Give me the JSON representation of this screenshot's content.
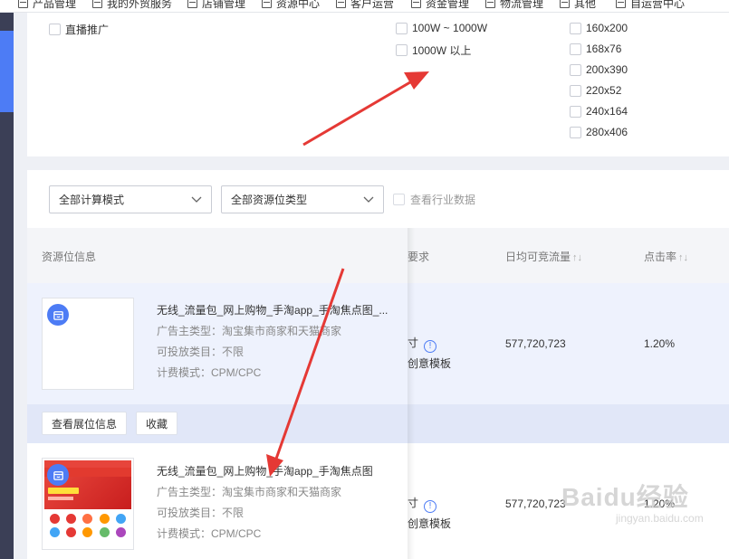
{
  "topnav": {
    "items": [
      "产品管理",
      "我的外贸服务",
      "店铺管理",
      "资源中心",
      "客户运营",
      "资金管理",
      "物流管理",
      "其他",
      "自运营中心"
    ]
  },
  "filters": {
    "promo_option": "直播推广",
    "traffic_options": [
      "100W ~ 1000W",
      "1000W 以上"
    ],
    "size_options": [
      "160x200",
      "168x76",
      "200x390",
      "220x52",
      "240x164",
      "280x406"
    ]
  },
  "toolbar": {
    "billing_select": "全部计算模式",
    "resource_type_select": "全部资源位类型",
    "industry_checkbox": "查看行业数据"
  },
  "table": {
    "headers": {
      "resource_info": "资源位信息",
      "requirement": "要求",
      "daily_traffic": "日均可竞流量",
      "ctr": "点击率",
      "sort_glyph": "↑↓"
    },
    "rows": [
      {
        "title": "无线_流量包_网上购物_手淘app_手淘焦点图_...",
        "advertiser": "广告主类型：淘宝集市商家和天猫商家",
        "category": "可投放类目：不限",
        "billing": "计费模式：CPM/CPC",
        "req_size": "寸",
        "req_template": "创意模板",
        "traffic": "577,720,723",
        "ctr": "1.20%"
      },
      {
        "title": "无线_流量包_网上购物_手淘app_手淘焦点图",
        "advertiser": "广告主类型：淘宝集市商家和天猫商家",
        "category": "可投放类目：不限",
        "billing": "计费模式：CPM/CPC",
        "req_size": "寸",
        "req_template": "创意模板",
        "traffic": "577,720,723",
        "ctr": "1.20%"
      }
    ],
    "actions": {
      "view_button": "查看展位信息",
      "favorite_button": "收藏"
    }
  },
  "watermark": {
    "brand": "Baidu经验",
    "url": "jingyan.baidu.com"
  },
  "colors": {
    "accent": "#4d7cf5",
    "arrow": "#e53935",
    "sidebar": "#3b3f56"
  }
}
